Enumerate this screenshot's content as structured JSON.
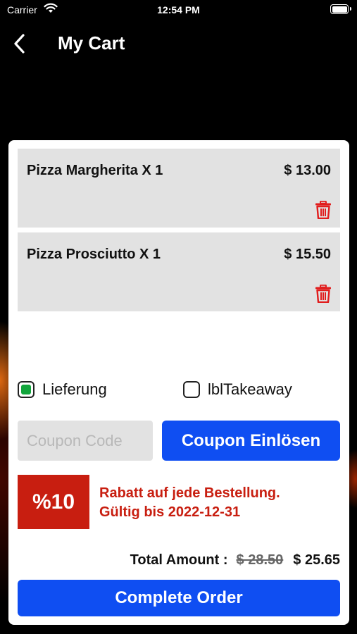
{
  "status_bar": {
    "carrier": "Carrier",
    "time": "12:54 PM"
  },
  "nav": {
    "title": "My Cart",
    "back_icon": "chevron-left-icon"
  },
  "cart": {
    "items": [
      {
        "name": "Pizza Margherita X 1",
        "price": "$ 13.00",
        "delete_icon": "trash-icon"
      },
      {
        "name": "Pizza Prosciutto X 1",
        "price": "$ 15.50",
        "delete_icon": "trash-icon"
      }
    ]
  },
  "delivery_options": [
    {
      "label": "Lieferung",
      "checked": true
    },
    {
      "label": "lblTakeaway",
      "checked": false
    }
  ],
  "coupon": {
    "placeholder": "Coupon Code",
    "value": "",
    "button_label": "Coupon Einlösen"
  },
  "discount": {
    "badge": "%10",
    "line1": "Rabatt auf jede Bestellung.",
    "line2": "Gültig bis 2022-12-31"
  },
  "total": {
    "label": "Total Amount :",
    "original": "$ 28.50",
    "discounted": "$ 25.65"
  },
  "complete_button_label": "Complete Order",
  "colors": {
    "accent_blue": "#0f4ef2",
    "discount_red": "#c81e10",
    "checkbox_green": "#11a53b",
    "trash_red": "#e11d1d",
    "item_bg": "#e2e2e2",
    "background": "#000000"
  }
}
